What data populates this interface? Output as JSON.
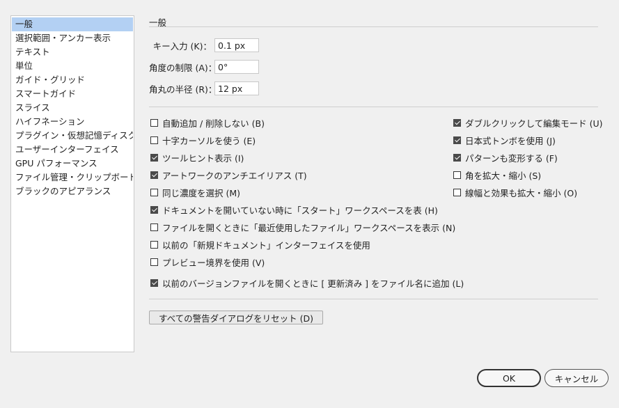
{
  "sidebar": {
    "items": [
      {
        "label": "一般"
      },
      {
        "label": "選択範囲・アンカー表示"
      },
      {
        "label": "テキスト"
      },
      {
        "label": "単位"
      },
      {
        "label": "ガイド・グリッド"
      },
      {
        "label": "スマートガイド"
      },
      {
        "label": "スライス"
      },
      {
        "label": "ハイフネーション"
      },
      {
        "label": "プラグイン・仮想記憶ディスク"
      },
      {
        "label": "ユーザーインターフェイス"
      },
      {
        "label": "GPU パフォーマンス"
      },
      {
        "label": "ファイル管理・クリップボード"
      },
      {
        "label": "ブラックのアピアランス"
      }
    ],
    "selected_index": 0
  },
  "main": {
    "title": "一般",
    "fields": {
      "keyboard_increment": {
        "label": "キー入力 (K)：",
        "value": "0.1 px"
      },
      "constrain_angle": {
        "label": "角度の制限 (A)：",
        "value": "0°"
      },
      "corner_radius": {
        "label": "角丸の半径 (R)：",
        "value": "12 px"
      }
    },
    "checkboxes_left": [
      {
        "label": "自動追加 / 削除しない (B)",
        "checked": false
      },
      {
        "label": "十字カーソルを使う (E)",
        "checked": false
      },
      {
        "label": "ツールヒント表示 (I)",
        "checked": true
      },
      {
        "label": "アートワークのアンチエイリアス (T)",
        "checked": true
      },
      {
        "label": "同じ濃度を選択 (M)",
        "checked": false
      },
      {
        "label": "ドキュメントを開いていない時に「スタート」ワークスペースを表 (H)",
        "checked": true
      },
      {
        "label": "ファイルを開くときに「最近使用したファイル」ワークスペースを表示 (N)",
        "checked": false
      },
      {
        "label": "以前の「新規ドキュメント」インターフェイスを使用",
        "checked": false
      },
      {
        "label": "プレビュー境界を使用 (V)",
        "checked": false
      },
      {
        "label": "以前のバージョンファイルを開くときに [ 更新済み ] をファイル名に追加 (L)",
        "checked": true
      }
    ],
    "checkboxes_right": [
      {
        "label": "ダブルクリックして編集モード (U)",
        "checked": true
      },
      {
        "label": "日本式トンボを使用 (J)",
        "checked": true
      },
      {
        "label": "パターンも変形する (F)",
        "checked": true
      },
      {
        "label": "角を拡大・縮小 (S)",
        "checked": false
      },
      {
        "label": "線幅と効果も拡大・縮小 (O)",
        "checked": false
      }
    ],
    "reset_button": "すべての警告ダイアログをリセット (D)"
  },
  "footer": {
    "ok_label": "OK",
    "cancel_label": "キャンセル"
  }
}
